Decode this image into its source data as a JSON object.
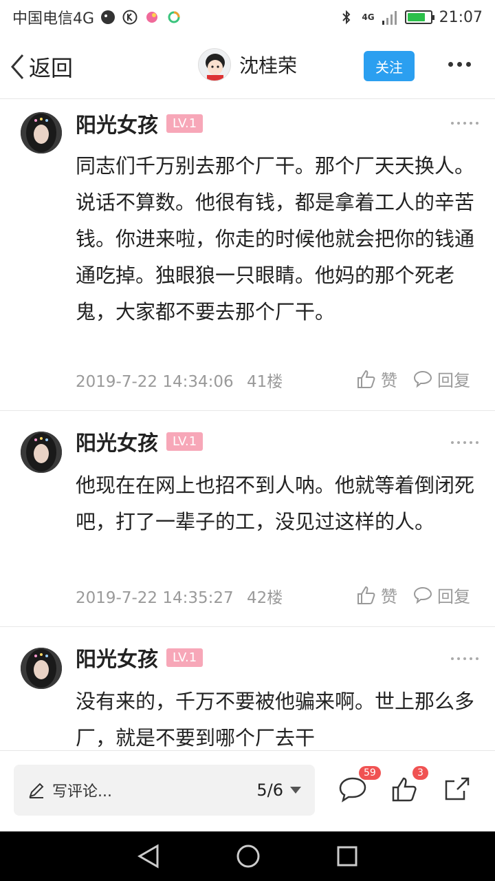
{
  "status_bar": {
    "carrier": "中国电信4G",
    "signal": "4G",
    "time": "21:07",
    "battery_level": 0.8
  },
  "header": {
    "back_label": "返回",
    "username": "沈桂荣",
    "follow_label": "关注"
  },
  "comments": [
    {
      "author": "阳光女孩",
      "level": "LV.1",
      "text": "同志们千万别去那个厂干。那个厂天天换人。说话不算数。他很有钱，都是拿着工人的辛苦钱。你进来啦，你走的时候他就会把你的钱通通吃掉。独眼狼一只眼睛。他妈的那个死老鬼，大家都不要去那个厂干。",
      "timestamp": "2019-7-22 14:34:06",
      "floor": "41楼",
      "like_label": "赞",
      "reply_label": "回复"
    },
    {
      "author": "阳光女孩",
      "level": "LV.1",
      "text": "他现在在网上也招不到人呐。他就等着倒闭死吧，打了一辈子的工，没见过这样的人。",
      "timestamp": "2019-7-22 14:35:27",
      "floor": "42楼",
      "like_label": "赞",
      "reply_label": "回复"
    },
    {
      "author": "阳光女孩",
      "level": "LV.1",
      "text": "没有来的，千万不要被他骗来啊。世上那么多厂，就是不要到哪个厂去干"
    }
  ],
  "bottom_bar": {
    "placeholder": "写评论...",
    "page": "5/6",
    "comment_count": "59",
    "like_count": "3"
  },
  "colors": {
    "accent": "#2b9ff0",
    "level_badge": "#f7a7b8",
    "count_badge": "#f05252"
  },
  "icons": [
    "back-chevron-icon",
    "pencil-icon",
    "comment-bubble-icon",
    "thumbs-up-icon",
    "share-icon"
  ]
}
